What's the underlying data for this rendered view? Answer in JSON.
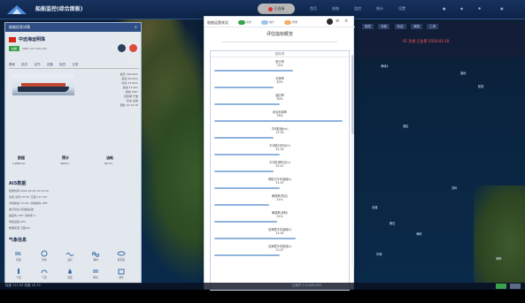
{
  "app": {
    "title": "船舶监控(综合面板)",
    "menu_items": [
      "首页",
      "船舶",
      "监控",
      "统计",
      "设置"
    ],
    "status_pill": "已连接"
  },
  "right_toolbar": {
    "items": [
      "图层",
      "测距",
      "轨迹",
      "海图",
      "工具"
    ],
    "alert": "01 异常 已告警 2024-05-18"
  },
  "map_labels": [
    "海域A",
    "锚地",
    "航道",
    "港区",
    "岛屿",
    "浅滩",
    "礁石",
    "海峡",
    "外海",
    "海岬"
  ],
  "left_panel": {
    "title": "船舶信息详情",
    "close": "×",
    "vessel_name": "中远海运明珠",
    "status_tag": "在航",
    "mmsi_label": "MMSI 413 000 000",
    "tabs": [
      "基础",
      "航次",
      "证书",
      "设备",
      "船员",
      "记录"
    ],
    "details": [
      "船长 330.00m",
      "船宽 48.00m",
      "吃水 15.60m",
      "航速 13.2kn",
      "航向 186°",
      "目的港 宁波",
      "状态 在航",
      "更新 10:24:18"
    ],
    "stats": [
      {
        "label": "航程",
        "value": "1,240 nm"
      },
      {
        "label": "预计",
        "value": "18.6 h"
      },
      {
        "label": "油耗",
        "value": "52.3 t"
      }
    ],
    "ais_title": "AIS数据",
    "ais_lines": [
      "接收时间 2024-05-18 10:24:18",
      "位置 北纬 18°42' 东经 111°05'",
      "对地航速 13.2kn 对地航向 186°",
      "航行状态 机动船在航",
      "船首向 185° 转向率 0",
      "导航设备 GPS",
      "数据来源 卫星AIS"
    ],
    "weather_title": "气象信息",
    "weather_items": [
      {
        "label": "风速"
      },
      {
        "label": "风向"
      },
      {
        "label": "浪高"
      },
      {
        "label": "涌向"
      },
      {
        "label": "能见度"
      },
      {
        "label": "气温"
      },
      {
        "label": "气压"
      },
      {
        "label": "湿度"
      },
      {
        "label": "降水"
      },
      {
        "label": "潮汐"
      }
    ]
  },
  "modal": {
    "title": "船舶运营状况",
    "toggles": [
      "实时",
      "统计",
      "预测"
    ],
    "subtitle": "评估指标概览",
    "list_header": "指标项",
    "metrics": [
      {
        "label": "航行率",
        "value": "72%",
        "fraction": 0.6
      },
      {
        "label": "在港率",
        "value": "40%",
        "fraction": 0.45
      },
      {
        "label": "锚泊率",
        "value": "50%",
        "fraction": 0.5
      },
      {
        "label": "综合利用率",
        "value": "78%",
        "fraction": 0.98
      },
      {
        "label": "平均航速(kn)",
        "value": "12.30",
        "fraction": 0.45
      },
      {
        "label": "平均航行时长(h)",
        "value": "42.30",
        "fraction": 0.5
      },
      {
        "label": "平均在港时长(h)",
        "value": "22.47",
        "fraction": 0.45
      },
      {
        "label": "单航次平均油耗(t)",
        "value": "31.97",
        "fraction": 0.5
      },
      {
        "label": "满载率(吨位)",
        "value": "41%",
        "fraction": 0.42
      },
      {
        "label": "满载率(体积)",
        "value": "51%",
        "fraction": 0.48
      },
      {
        "label": "百海里平均油耗(t)",
        "value": "15.34",
        "fraction": 0.62
      },
      {
        "label": "百海里平均排放(t)",
        "value": "10.27",
        "fraction": 0.5
      }
    ]
  },
  "bottom_bar": {
    "left": "经度 111.05 纬度 18.70",
    "center": "比例尺 1:2,000,000"
  }
}
